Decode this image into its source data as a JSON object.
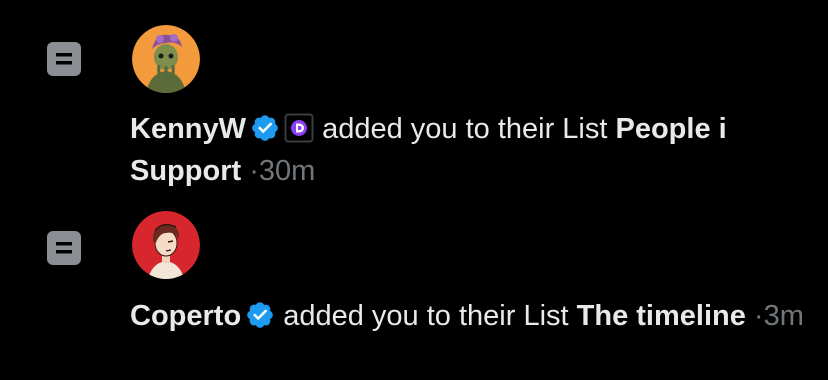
{
  "colors": {
    "background": "#000000",
    "text": "#e7e9ea",
    "muted": "#71767b",
    "verified": "#1d9bf0",
    "list_icon": "#8b8f94",
    "affiliate_badge": "#8b3cf7"
  },
  "notifications": [
    {
      "icon": "list-icon",
      "user_name": "KennyW",
      "verified": true,
      "affiliate_badge_icon": "affiliate-badge-icon",
      "action_text": "added you to their List",
      "list_name": "People i Support",
      "separator": "·",
      "time": "30m"
    },
    {
      "icon": "list-icon",
      "user_name": "Coperto",
      "verified": true,
      "action_text": "added you to their List",
      "list_name": "The timeline",
      "separator": "·",
      "time": "3m"
    }
  ]
}
